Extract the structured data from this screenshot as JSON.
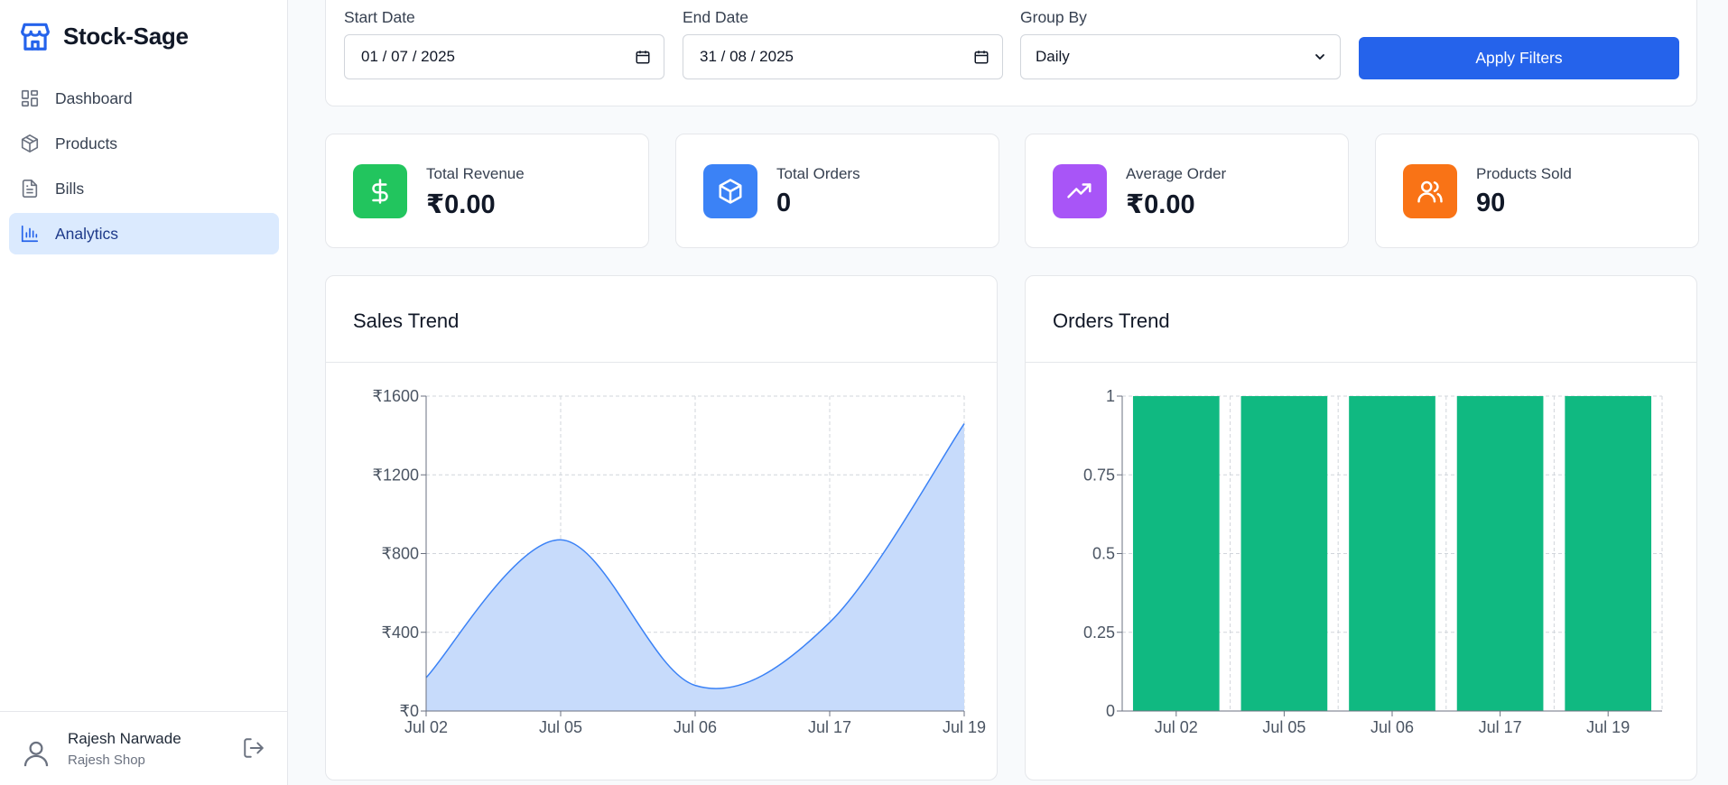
{
  "brand": {
    "name": "Stock-Sage",
    "icon": "store-icon"
  },
  "nav": [
    {
      "label": "Dashboard",
      "icon": "dashboard-icon",
      "active": false
    },
    {
      "label": "Products",
      "icon": "package-icon",
      "active": false
    },
    {
      "label": "Bills",
      "icon": "file-icon",
      "active": false
    },
    {
      "label": "Analytics",
      "icon": "bar-chart-icon",
      "active": true
    }
  ],
  "user": {
    "name": "Rajesh Narwade",
    "shop": "Rajesh Shop"
  },
  "filters": {
    "start_label": "Start Date",
    "start_value": "01 / 07 / 2025",
    "end_label": "End Date",
    "end_value": "31 / 08 / 2025",
    "group_label": "Group By",
    "group_value": "Daily",
    "apply_label": "Apply Filters"
  },
  "stats": [
    {
      "label": "Total Revenue",
      "value": "₹0.00",
      "icon": "dollar-icon",
      "color": "#22c55e"
    },
    {
      "label": "Total Orders",
      "value": "0",
      "icon": "box-icon",
      "color": "#3b82f6"
    },
    {
      "label": "Average Order",
      "value": "₹0.00",
      "icon": "trending-up-icon",
      "color": "#a855f7"
    },
    {
      "label": "Products Sold",
      "value": "90",
      "icon": "users-icon",
      "color": "#f97316"
    }
  ],
  "colors": {
    "primary": "#2563eb",
    "area_fill": "#c7dbfb",
    "area_stroke": "#3b82f6",
    "bar": "#10b981"
  },
  "chart_data": [
    {
      "type": "area",
      "title": "Sales Trend",
      "categories": [
        "Jul 02",
        "Jul 05",
        "Jul 06",
        "Jul 17",
        "Jul 19"
      ],
      "values": [
        170,
        870,
        130,
        450,
        1460
      ],
      "ylim": [
        0,
        1600
      ],
      "yticks": [
        0,
        400,
        800,
        1200,
        1600
      ],
      "ytick_labels": [
        "₹0",
        "₹400",
        "₹800",
        "₹1200",
        "₹1600"
      ],
      "grid": true
    },
    {
      "type": "bar",
      "title": "Orders Trend",
      "categories": [
        "Jul 02",
        "Jul 05",
        "Jul 06",
        "Jul 17",
        "Jul 19"
      ],
      "values": [
        1,
        1,
        1,
        1,
        1
      ],
      "ylim": [
        0,
        1
      ],
      "yticks": [
        0,
        0.25,
        0.5,
        0.75,
        1
      ],
      "ytick_labels": [
        "0",
        "0.25",
        "0.5",
        "0.75",
        "1"
      ],
      "grid": true
    }
  ]
}
